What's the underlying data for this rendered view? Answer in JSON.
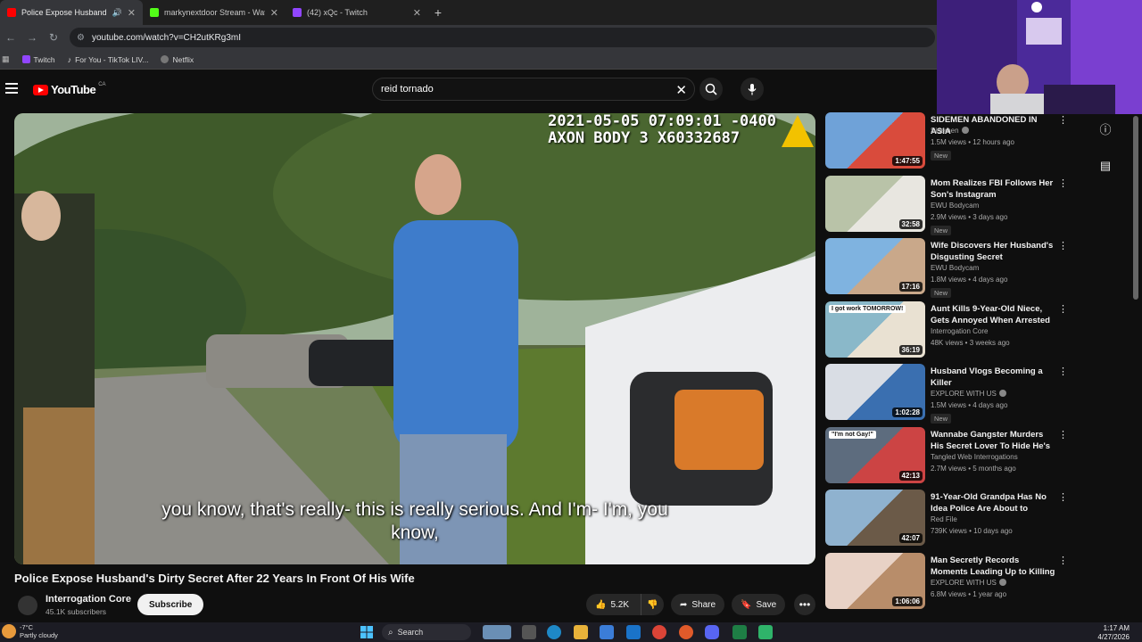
{
  "browser": {
    "tabs": [
      {
        "title": "Police Expose Husband's D",
        "active": true,
        "favicon_color": "#ff0000",
        "has_sound_icon": true
      },
      {
        "title": "markynextdoor Stream - Watch",
        "active": false,
        "favicon_color": "#53fc18"
      },
      {
        "title": "(42) xQc - Twitch",
        "active": false,
        "favicon_color": "#9146ff"
      }
    ],
    "new_tab_label": "+",
    "url": "youtube.com/watch?v=CH2utKRg3mI",
    "bookmarks": [
      {
        "label": "Twitch",
        "color": "#9146ff"
      },
      {
        "label": "For You - TikTok LIV...",
        "color": "#ffffff"
      },
      {
        "label": "Netflix",
        "color": "#bbbbbb"
      }
    ]
  },
  "youtube": {
    "logo_text": "YouTube",
    "country_code": "CA",
    "search_value": "reid tornado",
    "clear_symbol": "✕"
  },
  "video": {
    "timestamp_line1": "2021-05-05 07:09:01 -0400",
    "timestamp_line2": "AXON BODY 3 X60332687",
    "caption_line1": "you know, that's really- this is really serious. And I'm- I'm, you",
    "caption_line2": "know,",
    "title": "Police Expose Husband's Dirty Secret After 22 Years In Front Of His Wife",
    "channel_name": "Interrogation Core",
    "subscribers": "45.1K subscribers",
    "subscribe_label": "Subscribe",
    "like_count": "5.2K",
    "share_label": "Share",
    "save_label": "Save"
  },
  "recommendations": [
    {
      "title": "SIDEMEN ABANDONED IN ASIA",
      "channel": "Sidemen",
      "verified": true,
      "meta": "1.5M views • 12 hours ago",
      "is_new": true,
      "duration": "1:47:55",
      "thumb_colors": [
        "#6fa2d8",
        "#d94b3c"
      ]
    },
    {
      "title": "Mom Realizes FBI Follows Her Son's Instagram",
      "channel": "EWU Bodycam",
      "verified": false,
      "meta": "2.9M views • 3 days ago",
      "is_new": true,
      "duration": "32:58",
      "thumb_colors": [
        "#b9c3a8",
        "#e8e6e0"
      ]
    },
    {
      "title": "Wife Discovers Her Husband's Disgusting Secret",
      "channel": "EWU Bodycam",
      "verified": false,
      "meta": "1.8M views • 4 days ago",
      "is_new": true,
      "duration": "17:16",
      "thumb_colors": [
        "#7fb3e0",
        "#c9a88a"
      ]
    },
    {
      "title": "Aunt Kills 9-Year-Old Niece, Gets Annoyed When Arrested",
      "channel": "Interrogation Core",
      "verified": false,
      "meta": "48K views • 3 weeks ago",
      "is_new": false,
      "duration": "36:19",
      "thumb_colors": [
        "#8ab8c9",
        "#e9e1d2"
      ],
      "thumb_text": "I got work TOMORROW!"
    },
    {
      "title": "Husband Vlogs Becoming a Killer",
      "channel": "EXPLORE WITH US",
      "verified": true,
      "meta": "1.5M views • 4 days ago",
      "is_new": true,
      "duration": "1:02:28",
      "thumb_colors": [
        "#d9dde4",
        "#3a6fb0"
      ]
    },
    {
      "title": "Wannabe Gangster Murders His Secret Lover To Hide He's Gay",
      "channel": "Tangled Web Interrogations",
      "verified": false,
      "meta": "2.7M views • 5 months ago",
      "is_new": false,
      "duration": "42:13",
      "thumb_colors": [
        "#5d6c7e",
        "#c44"
      ],
      "thumb_text": "\"I'm not Gay!\""
    },
    {
      "title": "91-Year-Old Grandpa Has No Idea Police Are About to Arres...",
      "channel": "Red File",
      "verified": false,
      "meta": "739K views • 10 days ago",
      "is_new": false,
      "duration": "42:07",
      "thumb_colors": [
        "#8fb2cf",
        "#6b5a48"
      ]
    },
    {
      "title": "Man Secretly Records Moments Leading Up to Killing",
      "channel": "EXPLORE WITH US",
      "verified": true,
      "meta": "6.8M views • 1 year ago",
      "is_new": false,
      "duration": "1:06:06",
      "thumb_colors": [
        "#e8d2c6",
        "#b88d6a"
      ]
    }
  ],
  "new_badge_label": "New",
  "taskbar": {
    "temperature": "-7°C",
    "weather": "Partly cloudy",
    "search_label": "Search",
    "time": "1:17 AM",
    "date": "4/27/2026"
  }
}
